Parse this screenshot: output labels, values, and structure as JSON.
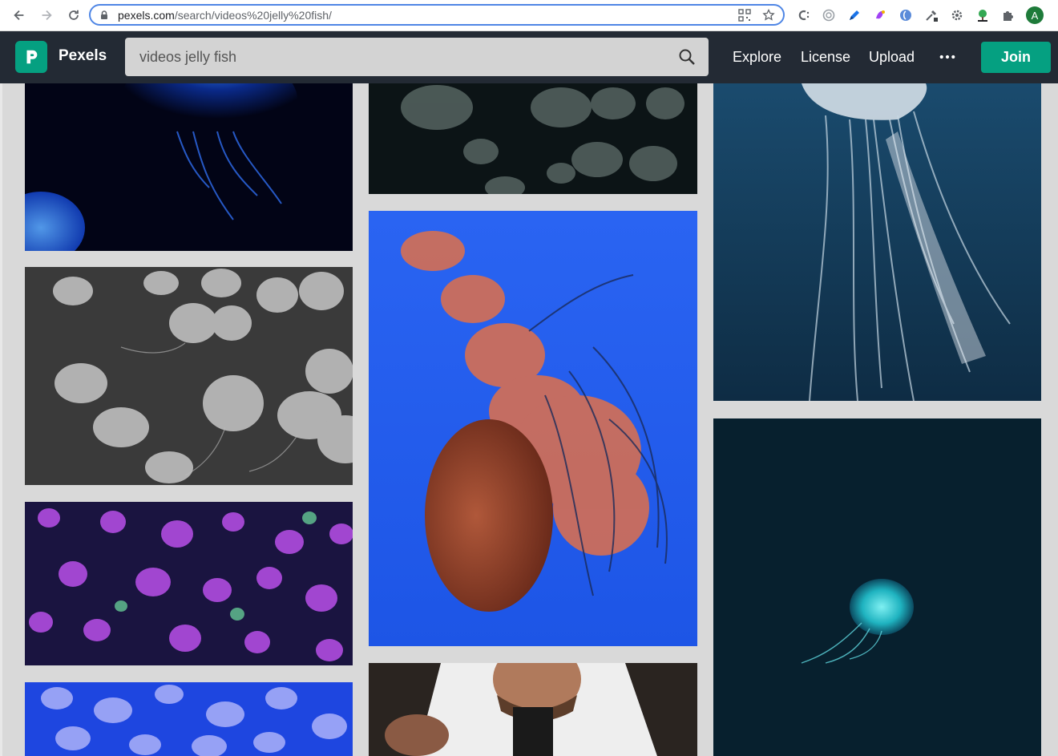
{
  "browser": {
    "url_host": "pexels.com",
    "url_path": "/search/videos%20jelly%20fish/",
    "profile_initial": "A"
  },
  "header": {
    "brand": "Pexels",
    "search_query": "videos jelly fish",
    "nav": {
      "explore": "Explore",
      "license": "License",
      "upload": "Upload",
      "more": "•••"
    },
    "join_label": "Join"
  },
  "colors": {
    "brand_green": "#05a081",
    "header_bg": "#232a34",
    "page_bg": "#d9d9d9"
  },
  "results": [
    {
      "id": "blue-glowing-jellyfish",
      "subject": "blue jellyfish"
    },
    {
      "id": "moon-jellyfish-dark",
      "subject": "moon jellyfish"
    },
    {
      "id": "white-jellyfish-tentacles",
      "subject": "jellyfish"
    },
    {
      "id": "monochrome-jellyfish",
      "subject": "jellyfish"
    },
    {
      "id": "sea-nettle-blue",
      "subject": "sea nettle"
    },
    {
      "id": "purple-jellyfish-swarm",
      "subject": "jellyfish"
    },
    {
      "id": "glowing-jellyfish-deep",
      "subject": "jellyfish"
    },
    {
      "id": "blue-jellyfish-swarm",
      "subject": "jellyfish"
    },
    {
      "id": "man-with-camera",
      "subject": "person"
    }
  ]
}
